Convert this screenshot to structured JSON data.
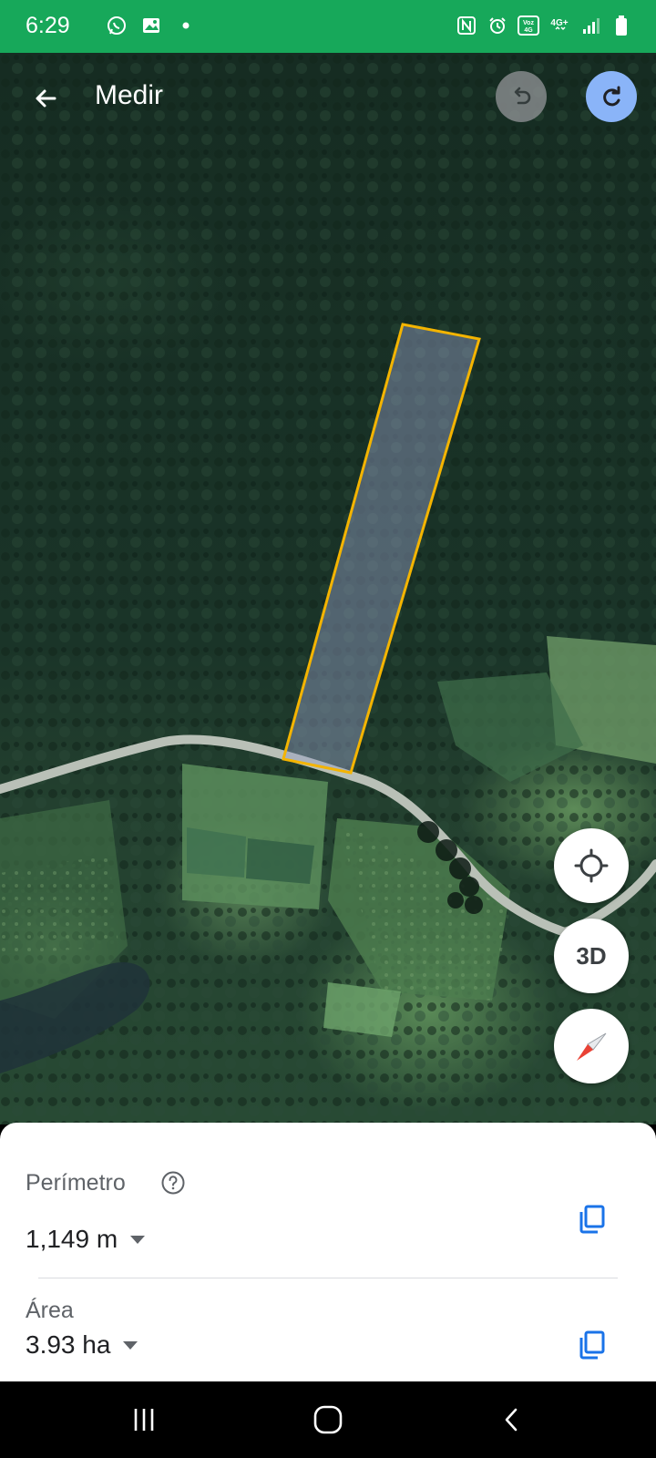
{
  "status_bar": {
    "time": "6:29",
    "left_icons": [
      "whatsapp-icon",
      "gallery-icon",
      "dot-icon"
    ],
    "right_icons": [
      "nfc-icon",
      "alarm-icon",
      "volte-icon",
      "4g-icon",
      "signal-icon",
      "battery-icon"
    ],
    "volte_text": "Voz\n4G",
    "network_text": "4G+"
  },
  "header": {
    "title": "Medir",
    "back_icon": "arrow-back-icon",
    "undo_icon": "undo-icon",
    "redo_icon": "redo-icon",
    "undo_enabled": false,
    "redo_enabled": true
  },
  "map": {
    "polygon_color": "#f4b400",
    "fab_location_icon": "my-location-icon",
    "fab_3d_label": "3D",
    "fab_compass_icon": "compass-icon"
  },
  "sheet": {
    "perimeter": {
      "label": "Perímetro",
      "value": "1,149 m",
      "help_icon": "help-icon",
      "copy_icon": "copy-icon"
    },
    "area": {
      "label": "Área",
      "value": "3.93 ha",
      "copy_icon": "copy-icon"
    },
    "accent_color": "#1a73e8"
  },
  "nav_bar": {
    "recents_icon": "recents-icon",
    "home_icon": "home-icon",
    "back_icon": "nav-back-icon"
  }
}
